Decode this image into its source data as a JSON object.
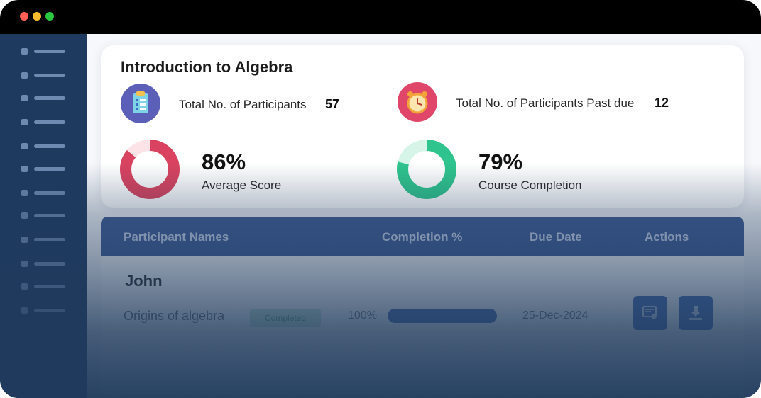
{
  "course": {
    "title": "Introduction to Algebra"
  },
  "stats": {
    "participants": {
      "label": "Total No. of Participants",
      "value": "57",
      "icon": "clipboard-icon",
      "color": "#5b5fb8"
    },
    "past_due": {
      "label": "Total No. of Participants Past due",
      "value": "12",
      "icon": "alarm-clock-icon",
      "color": "#e0466a"
    },
    "average_score": {
      "value_text": "86%",
      "value": 86,
      "label": "Average Score",
      "color": "#d9435f"
    },
    "course_completion": {
      "value_text": "79%",
      "value": 79,
      "label": "Course Completion",
      "color": "#2fc48d"
    }
  },
  "table": {
    "headers": [
      "Participant Names",
      "Completion %",
      "Due Date",
      "Actions"
    ],
    "rows": [
      {
        "name": "John",
        "module": "Origins of algebra",
        "status": "Completed",
        "completion_text": "100%",
        "completion": 100,
        "due_date": "25-Dec-2024",
        "actions": [
          "certificate-icon",
          "download-icon"
        ]
      }
    ]
  },
  "colors": {
    "header_bg": "#3f5c96",
    "sidebar_bg": "#1e3a5f",
    "accent": "#4a6fb6"
  }
}
